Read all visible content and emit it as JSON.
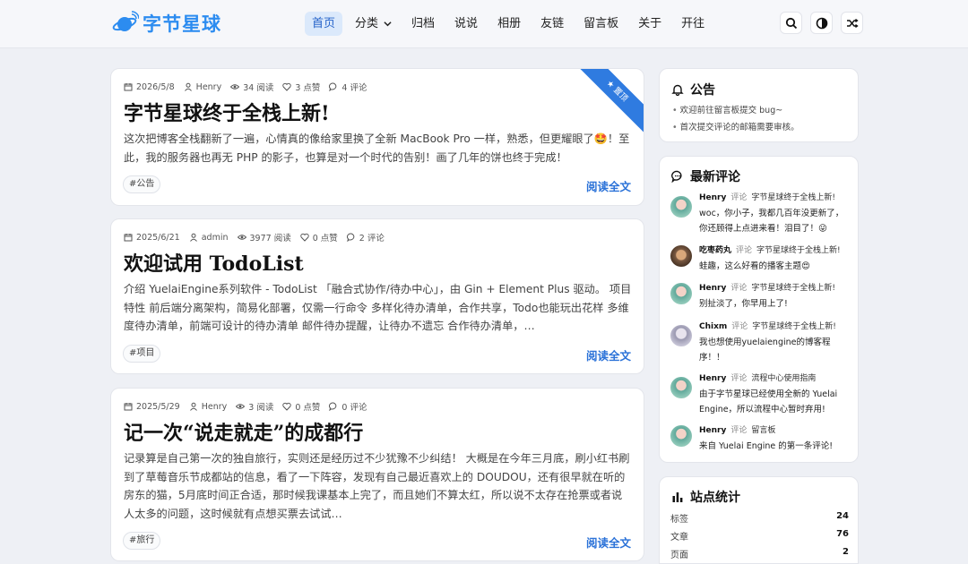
{
  "header": {
    "logo_text": "字节星球",
    "nav": [
      "首页",
      "分类",
      "归档",
      "说说",
      "相册",
      "友链",
      "留言板",
      "关于",
      "开往"
    ],
    "buttons": [
      "search-icon",
      "theme-toggle-icon",
      "random-icon"
    ]
  },
  "posts": [
    {
      "date": "2026/5/8",
      "author": "Henry",
      "views": "34 阅读",
      "likes": "3 点赞",
      "comments": "4 评论",
      "title": "字节星球终于全栈上新!",
      "excerpt": "这次把博客全栈翻新了一遍，心情真的像给家里换了全新 MacBook Pro 一样，熟悉，但更耀眼了🤩！至此，我的服务器也再无 PHP 的影子，也算是对一个时代的告别！画了几年的饼也终于完成！",
      "tag": "#公告",
      "read_more": "阅读全文",
      "ribbon": "★ 置顶"
    },
    {
      "date": "2025/6/21",
      "author": "admin",
      "views": "3977 阅读",
      "likes": "0 点赞",
      "comments": "2 评论",
      "title": "欢迎试用 TodoList",
      "excerpt": "介绍 YuelaiEngine系列软件 - TodoList 「融合式协作/待办中心」，由 Gin + Element Plus 驱动。 项目特性 前后端分离架构，简易化部署，仅需一行命令 多样化待办清单，合作共享，Todo也能玩出花样 多维度待办清单，前端可设计的待办清单 邮件待办提醒，让待办不遗忘 合作待办清单，…",
      "tag": "#项目",
      "read_more": "阅读全文"
    },
    {
      "date": "2025/5/29",
      "author": "Henry",
      "views": "3 阅读",
      "likes": "0 点赞",
      "comments": "0 评论",
      "title": "记一次“说走就走”的成都行",
      "excerpt": "记录算是自己第一次的独自旅行，实则还是经历过不少犹豫不少纠结！ 大概是在今年三月底，刷小红书刷到了草莓音乐节成都站的信息，看了一下阵容，发现有自己最近喜欢上的 DOUDOU，还有很早就在听的房东的猫，5月底时间正合适，那时候我课基本上完了，而且她们不算太红，所以说不太存在抢票或者说人太多的问题，这时候就有点想买票去试试…",
      "tag": "#旅行",
      "read_more": "阅读全文"
    }
  ],
  "notice": {
    "title": "公告",
    "items": [
      "欢迎前往留言板提交 bug~",
      "首次提交评论的邮箱需要审核。"
    ]
  },
  "recent_comments": {
    "title": "最新评论",
    "items": [
      {
        "user": "Henry",
        "verb": "评论",
        "target": "字节星球终于全栈上新!",
        "text": "woc，你小子，我都几百年没更新了，你还顾得上点进来看！泪目了！😜"
      },
      {
        "user": "吃枣药丸",
        "verb": "评论",
        "target": "字节星球终于全栈上新!",
        "text": "蛙趣，这么好看的播客主题😍"
      },
      {
        "user": "Henry",
        "verb": "评论",
        "target": "字节星球终于全栈上新!",
        "text": "别扯淡了，你早用上了!"
      },
      {
        "user": "Chixm",
        "verb": "评论",
        "target": "字节星球终于全栈上新!",
        "text": "我也想使用yuelaiengine的博客程序！！"
      },
      {
        "user": "Henry",
        "verb": "评论",
        "target": "流程中心使用指南",
        "text": "由于字节星球已经使用全新的 Yuelai Engine，所以流程中心暂时弃用!"
      },
      {
        "user": "Henry",
        "verb": "评论",
        "target": "留言板",
        "text": "来自 Yuelai Engine 的第一条评论!"
      }
    ]
  },
  "stats": {
    "title": "站点统计",
    "rows": [
      {
        "label": "标签",
        "value": "24"
      },
      {
        "label": "文章",
        "value": "76"
      },
      {
        "label": "页面",
        "value": "2"
      }
    ]
  },
  "colors": {
    "accent": "#2b72d8",
    "ribbon": "#2f7be0",
    "background": "#eef0f5"
  }
}
